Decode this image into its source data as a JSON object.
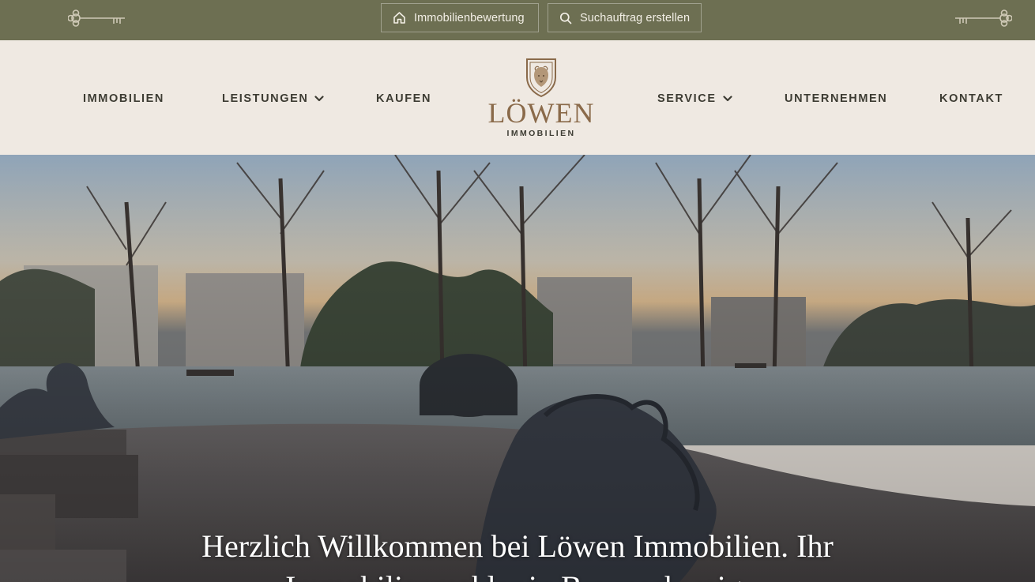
{
  "topbar": {
    "valuation_label": "Immobilienbewertung",
    "search_request_label": "Suchauftrag erstellen",
    "icons": {
      "left": "key-icon",
      "right": "key-icon",
      "valuation": "home-icon",
      "search": "search-icon"
    }
  },
  "nav": {
    "items": [
      {
        "label": "IMMOBILIEN",
        "dropdown": false
      },
      {
        "label": "LEISTUNGEN",
        "dropdown": true
      },
      {
        "label": "KAUFEN",
        "dropdown": false
      },
      {
        "label": "SERVICE",
        "dropdown": true
      },
      {
        "label": "UNTERNEHMEN",
        "dropdown": false
      },
      {
        "label": "KONTAKT",
        "dropdown": false
      }
    ]
  },
  "logo": {
    "brand": "LÖWEN",
    "sub": "IMMOBILIEN",
    "icon": "lion-crest-icon"
  },
  "hero": {
    "title": "Herzlich Willkommen bei Löwen Immobilien. Ihr Immobilienmakler in Braunschweig."
  },
  "colors": {
    "topbar_bg": "#6d6f52",
    "nav_bg": "#efe9e2",
    "brand": "#8a6a4a",
    "nav_text": "#3d3c33"
  }
}
